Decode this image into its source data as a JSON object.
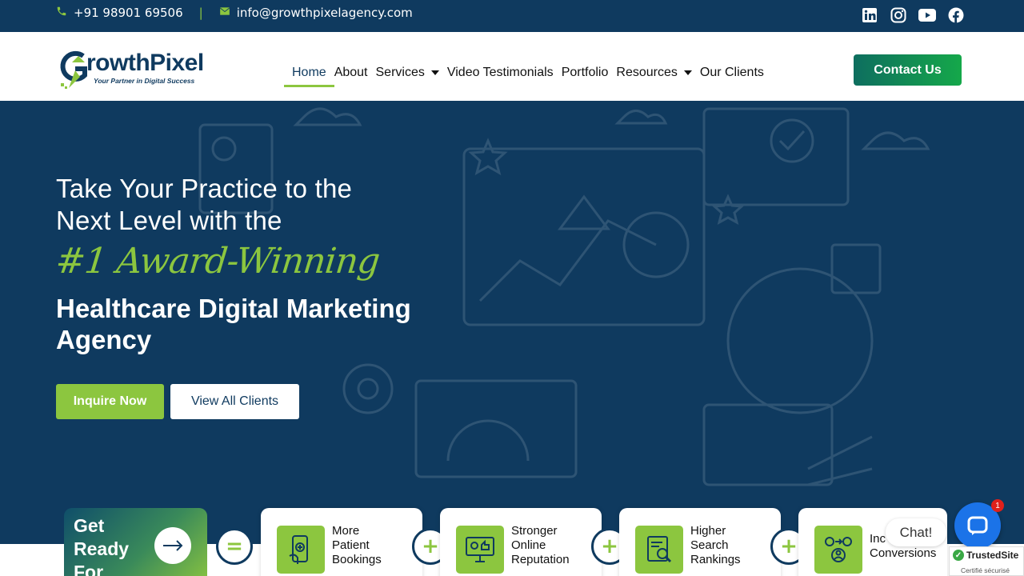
{
  "topbar": {
    "phone": "+91 98901 69506",
    "separator": "|",
    "email": "info@growthpixelagency.com",
    "socials": [
      "linkedin-icon",
      "instagram-icon",
      "youtube-icon",
      "facebook-icon"
    ]
  },
  "logo": {
    "word_part1": "rowth",
    "word_part2": "Pixel",
    "tagline": "Your Partner in Digital Success"
  },
  "nav": {
    "items": [
      {
        "label": "Home",
        "active": true
      },
      {
        "label": "About"
      },
      {
        "label": "Services",
        "dropdown": true
      },
      {
        "label": "Video Testimonials"
      },
      {
        "label": "Portfolio"
      },
      {
        "label": "Resources",
        "dropdown": true
      },
      {
        "label": "Our Clients"
      }
    ],
    "cta": "Contact Us"
  },
  "hero": {
    "title_line1": "Take Your Practice to the",
    "title_line2": "Next Level with the",
    "script": "#1 Award-Winning",
    "title_line3": "Healthcare Digital Marketing",
    "title_line4": "Agency",
    "btn_inquire": "Inquire Now",
    "btn_clients": "View All Clients"
  },
  "strip": {
    "ready_line1": "Get",
    "ready_line2": "Ready",
    "ready_line3": "For",
    "equals": "=",
    "plus": "+",
    "benefits": [
      {
        "l1": "More",
        "l2": "Patient",
        "l3": "Bookings"
      },
      {
        "l1": "Stronger",
        "l2": "Online",
        "l3": "Reputation"
      },
      {
        "l1": "Higher",
        "l2": "Search",
        "l3": "Rankings"
      },
      {
        "l1": "Inc",
        "l2": "Conversions",
        "l3": ""
      }
    ]
  },
  "chat": {
    "label": "Chat!",
    "badge": "1"
  },
  "trusted": {
    "title": "TrustedSite",
    "sub": "Certifié sécurisé"
  },
  "colors": {
    "navy": "#0f3a5f",
    "green": "#8cc63f"
  }
}
